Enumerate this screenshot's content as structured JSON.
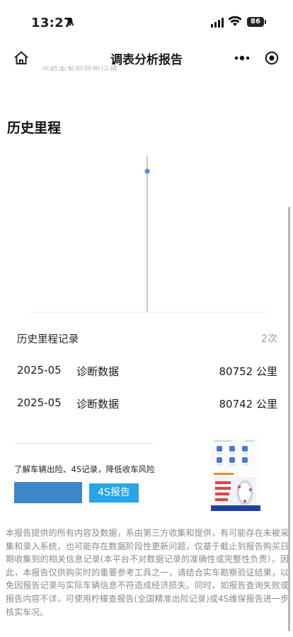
{
  "status_bar": {
    "time": "13:27",
    "battery": "86"
  },
  "nav": {
    "title": "调表分析报告"
  },
  "cut_notice": "当前未发现异常记录",
  "section": {
    "title": "历史里程"
  },
  "chart_data": {
    "type": "scatter",
    "title": "",
    "xlabel": "",
    "ylabel": "",
    "x": [
      "2025-05"
    ],
    "y": [
      80752
    ],
    "colors": {
      "point": "#4a90e2",
      "line": "#8e8e8e"
    }
  },
  "records": {
    "header": "历史里程记录",
    "count": "2次",
    "rows": [
      {
        "date": "2025-05",
        "type": "诊断数据",
        "mileage": "80752 公里"
      },
      {
        "date": "2025-05",
        "type": "诊断数据",
        "mileage": "80742 公里"
      }
    ]
  },
  "promo": {
    "text": "了解车辆出险、4S记录，降低收车风险",
    "button_label": "4S报告",
    "colors": {
      "primary": "#3d86c7",
      "secondary": "#27a5e8"
    }
  },
  "disclaimer": "本报告提供的所有内容及数据，系由第三方收集和提供，有可能存在未被采集和录入系统，也可能存在数据阶段性更新问题，仅基于截止到报告购买日期收集到的相关信息记录(本平台不对数据记录的准确性或完整性负责）。因此，本报告仅供购买时的重要参考工具之一，请结合实车勘察验证结果，以免因报告记录与实际车辆信息不符造成经济损失。同时，如报告查询失败或报告内容不详，可使用柠檬查报告(全国精准出险记录)或4S维保报告进一步核实车况。",
  "icons": [
    "bell-off-icon",
    "signal-icon",
    "wifi-icon",
    "battery-icon",
    "home-icon",
    "more-icon",
    "close-icon"
  ]
}
